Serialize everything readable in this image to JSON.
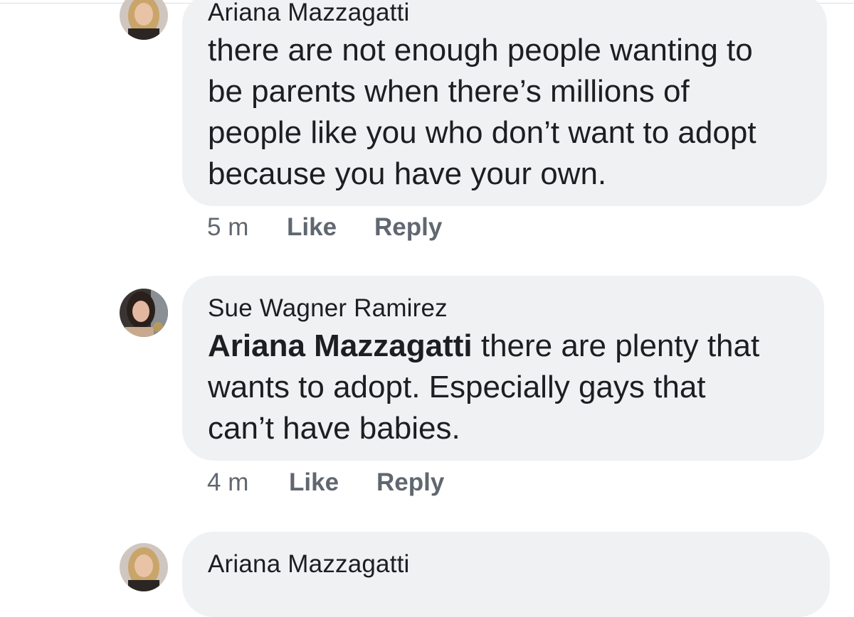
{
  "comments": [
    {
      "author": "Ariana Mazzagatti",
      "mention": "",
      "text": "there are not enough people wanting to\nbe parents when there’s millions of\npeople like you who don’t want to adopt\nbecause you have your own.",
      "time": "5 m",
      "like": "Like",
      "reply": "Reply"
    },
    {
      "author": "Sue Wagner Ramirez",
      "mention": "Ariana Mazzagatti",
      "text": " there are plenty that\nwants to adopt. Especially gays that\ncan’t have babies.",
      "time": "4 m",
      "like": "Like",
      "reply": "Reply"
    },
    {
      "author": "Ariana Mazzagatti"
    }
  ],
  "colors": {
    "bubble": "#f0f1f3",
    "text": "#1c1e21",
    "meta": "#606770"
  }
}
